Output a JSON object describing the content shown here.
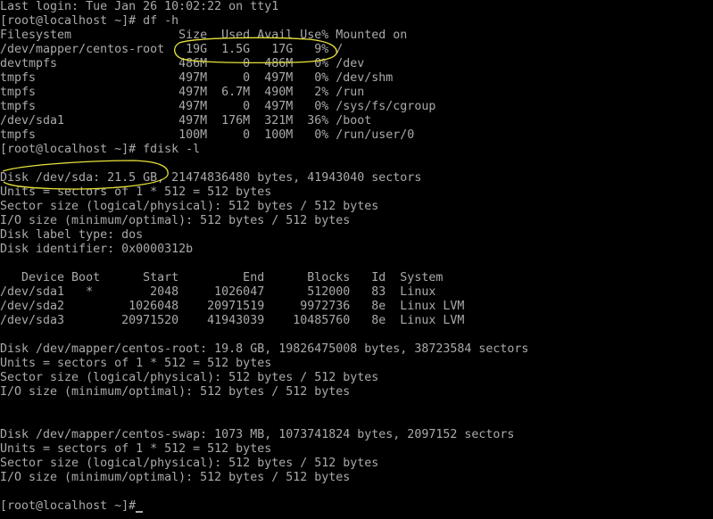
{
  "terminal": {
    "foreground": "#aaaaaa",
    "background": "#000000",
    "annotation_color": "#e8e23a",
    "lines": [
      "Last login: Tue Jan 26 10:02:22 on tty1",
      "[root@localhost ~]# df -h",
      "Filesystem               Size  Used Avail Use% Mounted on",
      "/dev/mapper/centos-root   19G  1.5G   17G   9% /",
      "devtmpfs                 486M     0  486M   0% /dev",
      "tmpfs                    497M     0  497M   0% /dev/shm",
      "tmpfs                    497M  6.7M  490M   2% /run",
      "tmpfs                    497M     0  497M   0% /sys/fs/cgroup",
      "/dev/sda1                497M  176M  321M  36% /boot",
      "tmpfs                    100M     0  100M   0% /run/user/0",
      "[root@localhost ~]# fdisk -l",
      "",
      "Disk /dev/sda: 21.5 GB, 21474836480 bytes, 41943040 sectors",
      "Units = sectors of 1 * 512 = 512 bytes",
      "Sector size (logical/physical): 512 bytes / 512 bytes",
      "I/O size (minimum/optimal): 512 bytes / 512 bytes",
      "Disk label type: dos",
      "Disk identifier: 0x0000312b",
      "",
      "   Device Boot      Start         End      Blocks   Id  System",
      "/dev/sda1   *        2048     1026047      512000   83  Linux",
      "/dev/sda2         1026048    20971519     9972736   8e  Linux LVM",
      "/dev/sda3        20971520    41943039    10485760   8e  Linux LVM",
      "",
      "Disk /dev/mapper/centos-root: 19.8 GB, 19826475008 bytes, 38723584 sectors",
      "Units = sectors of 1 * 512 = 512 bytes",
      "Sector size (logical/physical): 512 bytes / 512 bytes",
      "I/O size (minimum/optimal): 512 bytes / 512 bytes",
      "",
      "",
      "Disk /dev/mapper/centos-swap: 1073 MB, 1073741824 bytes, 2097152 sectors",
      "Units = sectors of 1 * 512 = 512 bytes",
      "Sector size (logical/physical): 512 bytes / 512 bytes",
      "I/O size (minimum/optimal): 512 bytes / 512 bytes",
      "",
      "[root@localhost ~]#"
    ]
  }
}
